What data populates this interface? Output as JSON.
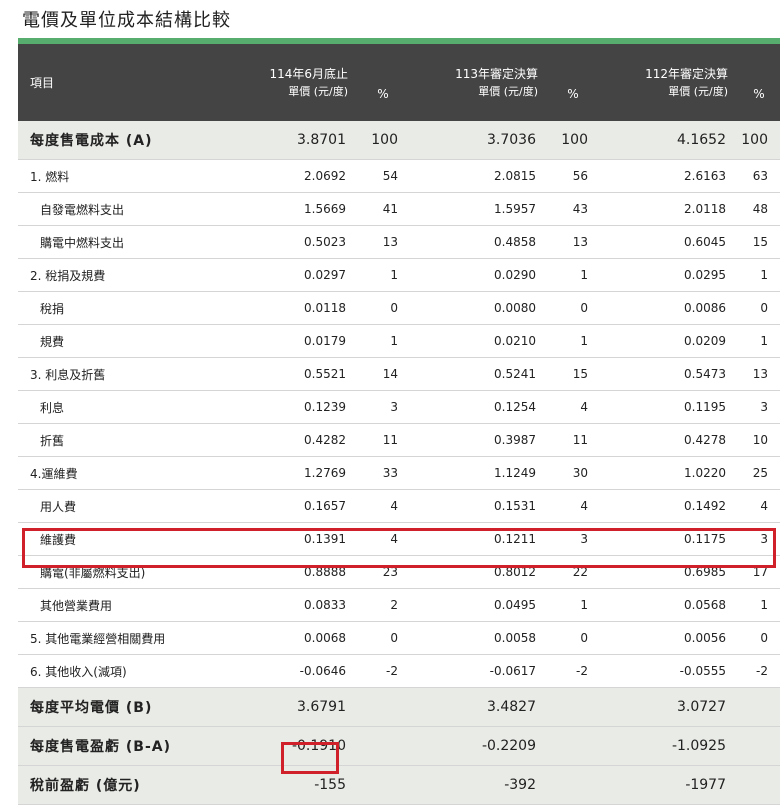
{
  "title": "電價及單位成本結構比較",
  "header": {
    "item": "項目",
    "periods": [
      {
        "name": "114年6月底止",
        "unit": "單價 (元/度)",
        "pct": "%"
      },
      {
        "name": "113年審定決算",
        "unit": "單價 (元/度)",
        "pct": "%"
      },
      {
        "name": "112年審定決算",
        "unit": "單價 (元/度)",
        "pct": "%"
      }
    ]
  },
  "rows": [
    {
      "label": "每度售電成本 (A)",
      "v1": "3.8701",
      "p1": "100",
      "v2": "3.7036",
      "p2": "100",
      "v3": "4.1652",
      "p3": "100"
    },
    {
      "label": "1. 燃料",
      "v1": "2.0692",
      "p1": "54",
      "v2": "2.0815",
      "p2": "56",
      "v3": "2.6163",
      "p3": "63"
    },
    {
      "label": "自發電燃料支出",
      "v1": "1.5669",
      "p1": "41",
      "v2": "1.5957",
      "p2": "43",
      "v3": "2.0118",
      "p3": "48"
    },
    {
      "label": "購電中燃料支出",
      "v1": "0.5023",
      "p1": "13",
      "v2": "0.4858",
      "p2": "13",
      "v3": "0.6045",
      "p3": "15"
    },
    {
      "label": "2. 稅捐及規費",
      "v1": "0.0297",
      "p1": "1",
      "v2": "0.0290",
      "p2": "1",
      "v3": "0.0295",
      "p3": "1"
    },
    {
      "label": "稅捐",
      "v1": "0.0118",
      "p1": "0",
      "v2": "0.0080",
      "p2": "0",
      "v3": "0.0086",
      "p3": "0"
    },
    {
      "label": "規費",
      "v1": "0.0179",
      "p1": "1",
      "v2": "0.0210",
      "p2": "1",
      "v3": "0.0209",
      "p3": "1"
    },
    {
      "label": "3. 利息及折舊",
      "v1": "0.5521",
      "p1": "14",
      "v2": "0.5241",
      "p2": "15",
      "v3": "0.5473",
      "p3": "13"
    },
    {
      "label": "利息",
      "v1": "0.1239",
      "p1": "3",
      "v2": "0.1254",
      "p2": "4",
      "v3": "0.1195",
      "p3": "3"
    },
    {
      "label": "折舊",
      "v1": "0.4282",
      "p1": "11",
      "v2": "0.3987",
      "p2": "11",
      "v3": "0.4278",
      "p3": "10"
    },
    {
      "label": "4.運維費",
      "v1": "1.2769",
      "p1": "33",
      "v2": "1.1249",
      "p2": "30",
      "v3": "1.0220",
      "p3": "25"
    },
    {
      "label": "用人費",
      "v1": "0.1657",
      "p1": "4",
      "v2": "0.1531",
      "p2": "4",
      "v3": "0.1492",
      "p3": "4"
    },
    {
      "label": "維護費",
      "v1": "0.1391",
      "p1": "4",
      "v2": "0.1211",
      "p2": "3",
      "v3": "0.1175",
      "p3": "3"
    },
    {
      "label": "購電(非屬燃料支出)",
      "v1": "0.8888",
      "p1": "23",
      "v2": "0.8012",
      "p2": "22",
      "v3": "0.6985",
      "p3": "17"
    },
    {
      "label": "其他營業費用",
      "v1": "0.0833",
      "p1": "2",
      "v2": "0.0495",
      "p2": "1",
      "v3": "0.0568",
      "p3": "1"
    },
    {
      "label": "5. 其他電業經營相關費用",
      "v1": "0.0068",
      "p1": "0",
      "v2": "0.0058",
      "p2": "0",
      "v3": "0.0056",
      "p3": "0"
    },
    {
      "label": "6. 其他收入(減項)",
      "v1": "-0.0646",
      "p1": "-2",
      "v2": "-0.0617",
      "p2": "-2",
      "v3": "-0.0555",
      "p3": "-2"
    },
    {
      "label": "每度平均電價 (B)",
      "v1": "3.6791",
      "p1": "",
      "v2": "3.4827",
      "p2": "",
      "v3": "3.0727",
      "p3": ""
    },
    {
      "label": "每度售電盈虧 (B-A)",
      "v1": "-0.1910",
      "p1": "",
      "v2": "-0.2209",
      "p2": "",
      "v3": "-1.0925",
      "p3": ""
    },
    {
      "label": "稅前盈虧 (億元)",
      "v1": "-155",
      "p1": "",
      "v2": "-392",
      "p2": "",
      "v3": "-1977",
      "p3": ""
    }
  ],
  "highlight_color": "#d0202a",
  "header_bg": "#444444",
  "accent_green": "#56ad6e"
}
